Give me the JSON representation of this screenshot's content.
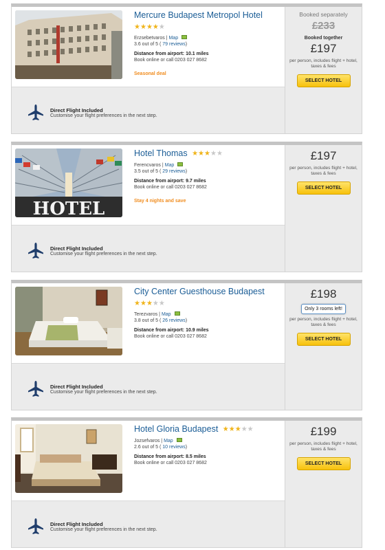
{
  "hotels": [
    {
      "name": "Mercure Budapest Metropol Hotel",
      "stars": 4,
      "district": "Erzsebetvaros",
      "map_label": "Map",
      "rating_text": "3.6 out of 5 (",
      "reviews_label": "79 reviews",
      "rating_close": ")",
      "distance": "Distance from airport: 10.1 miles",
      "book_text": "Book online or call 0203 027 8682",
      "promo": "Seasonal deal",
      "booked_separately_label": "Booked separately",
      "old_price": "£233",
      "booked_together_label": "Booked together",
      "price": "£197",
      "price_note": "per person, includes flight + hotel, taxes & fees",
      "select_label": "SELECT HOTEL",
      "flight_title": "Direct Flight Included",
      "flight_sub": "Customise your flight preferences in the next step."
    },
    {
      "name": "Hotel Thomas",
      "stars": 3,
      "district": "Ferencvaros",
      "map_label": "Map",
      "rating_text": "3.5 out of 5 (",
      "reviews_label": "29 reviews",
      "rating_close": ")",
      "distance": "Distance from airport: 9.7 miles",
      "book_text": "Book online or call 0203 027 8682",
      "promo": "Stay 4 nights and save",
      "photo_sign": "HOTEL",
      "price": "£197",
      "price_note": "per person, includes flight + hotel, taxes & fees",
      "select_label": "SELECT HOTEL",
      "flight_title": "Direct Flight Included",
      "flight_sub": "Customise your flight preferences in the next step."
    },
    {
      "name": "City Center Guesthouse Budapest",
      "stars": 3,
      "district": "Terezvaros",
      "map_label": "Map",
      "rating_text": "3.8 out of 5 (",
      "reviews_label": "26 reviews",
      "rating_close": ")",
      "distance": "Distance from airport: 10.9 miles",
      "book_text": "Book online or call 0203 027 8682",
      "price": "£198",
      "rooms_left": "Only 3 rooms left!",
      "price_note": "per person, includes flight + hotel, taxes & fees",
      "select_label": "SELECT HOTEL",
      "flight_title": "Direct Flight Included",
      "flight_sub": "Customise your flight preferences in the next step."
    },
    {
      "name": "Hotel Gloria Budapest",
      "stars": 3,
      "district": "Jozsefvaros",
      "map_label": "Map",
      "rating_text": "2.6 out of 5 (",
      "reviews_label": "10 reviews",
      "rating_close": ")",
      "distance": "Distance from airport: 8.5 miles",
      "book_text": "Book online or call 0203 027 8682",
      "price": "£199",
      "price_note": "per person, includes flight + hotel, taxes & fees",
      "select_label": "SELECT HOTEL",
      "flight_title": "Direct Flight Included",
      "flight_sub": "Customise your flight preferences in the next step."
    }
  ],
  "colors": {
    "link": "#1b5d96",
    "star_on": "#f0b41a",
    "star_off": "#c8c8c8",
    "promo": "#f08c1e",
    "button": "#f7c10c"
  },
  "icons": {
    "flight": "airplane-icon",
    "map": "map-icon",
    "star": "star-icon"
  }
}
